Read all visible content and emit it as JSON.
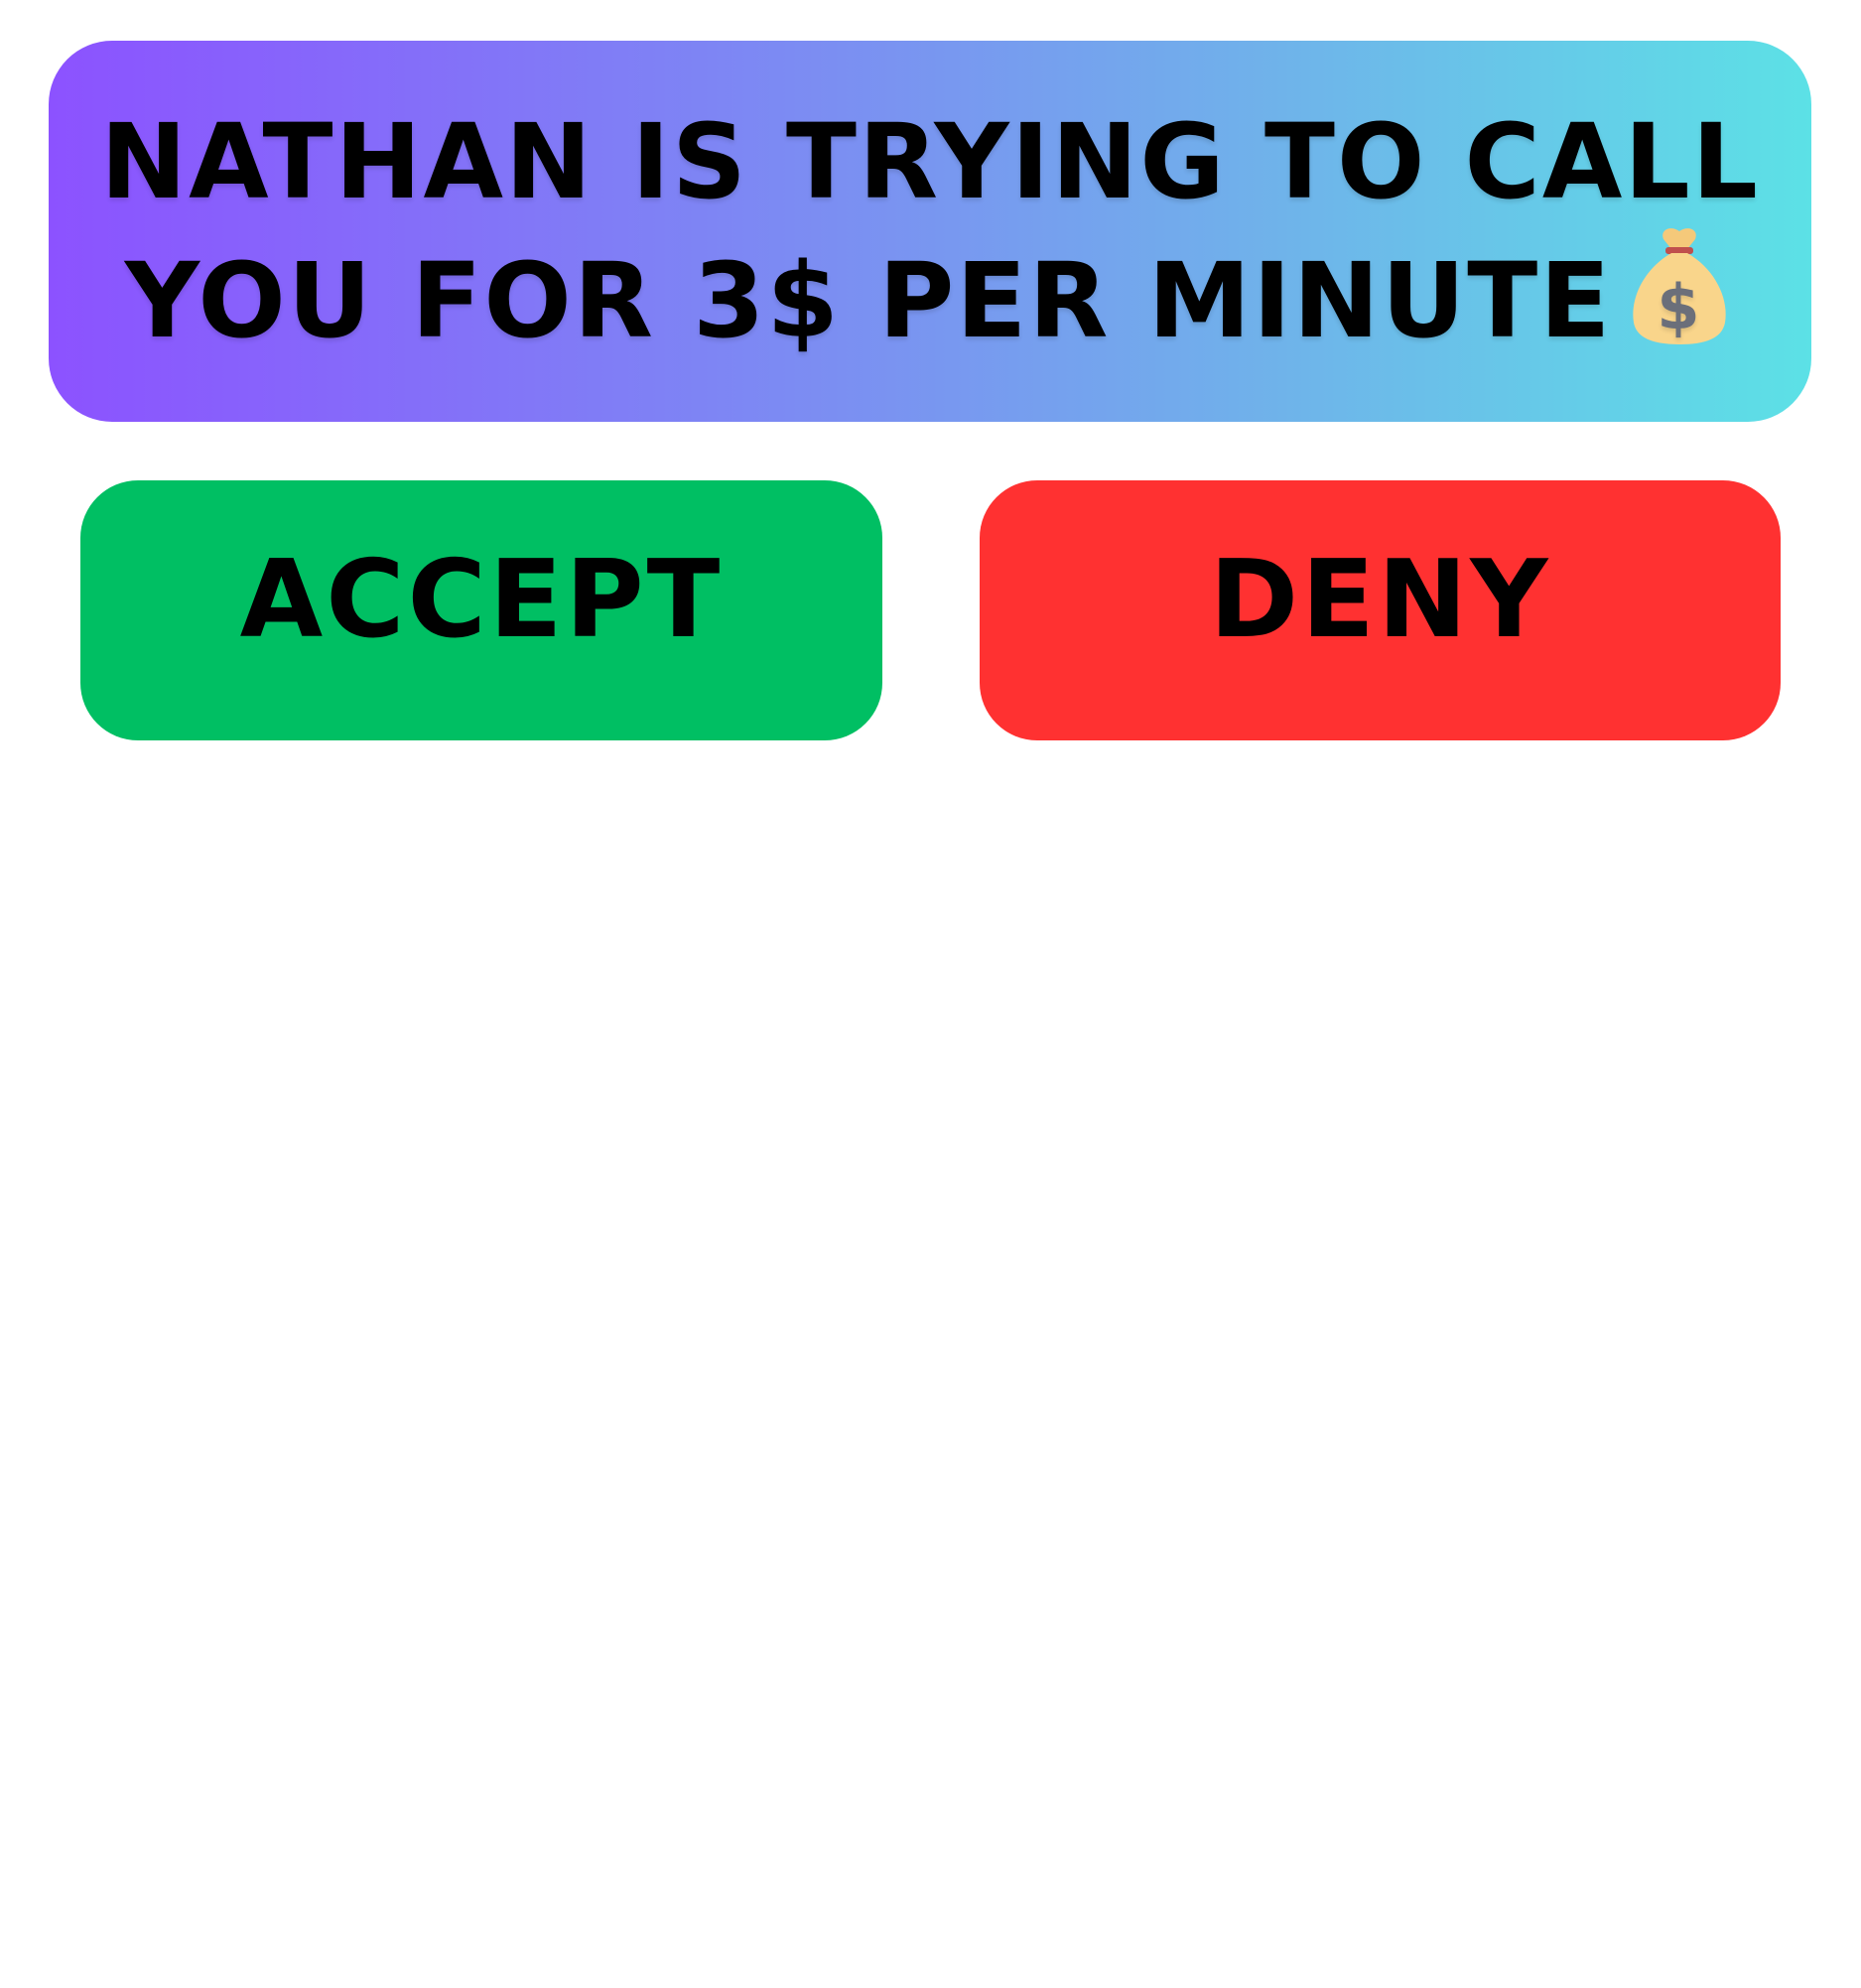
{
  "banner": {
    "line1": "Nathan is trying to call",
    "line2": "you for 3$ per minute",
    "icon": "money-bag-icon"
  },
  "actions": {
    "accept_label": "Accept",
    "deny_label": "Deny"
  },
  "colors": {
    "gradient_start": "#8c52ff",
    "gradient_end": "#5ce1e6",
    "accept": "#00bf63",
    "deny": "#ff3131",
    "text": "#000000"
  }
}
